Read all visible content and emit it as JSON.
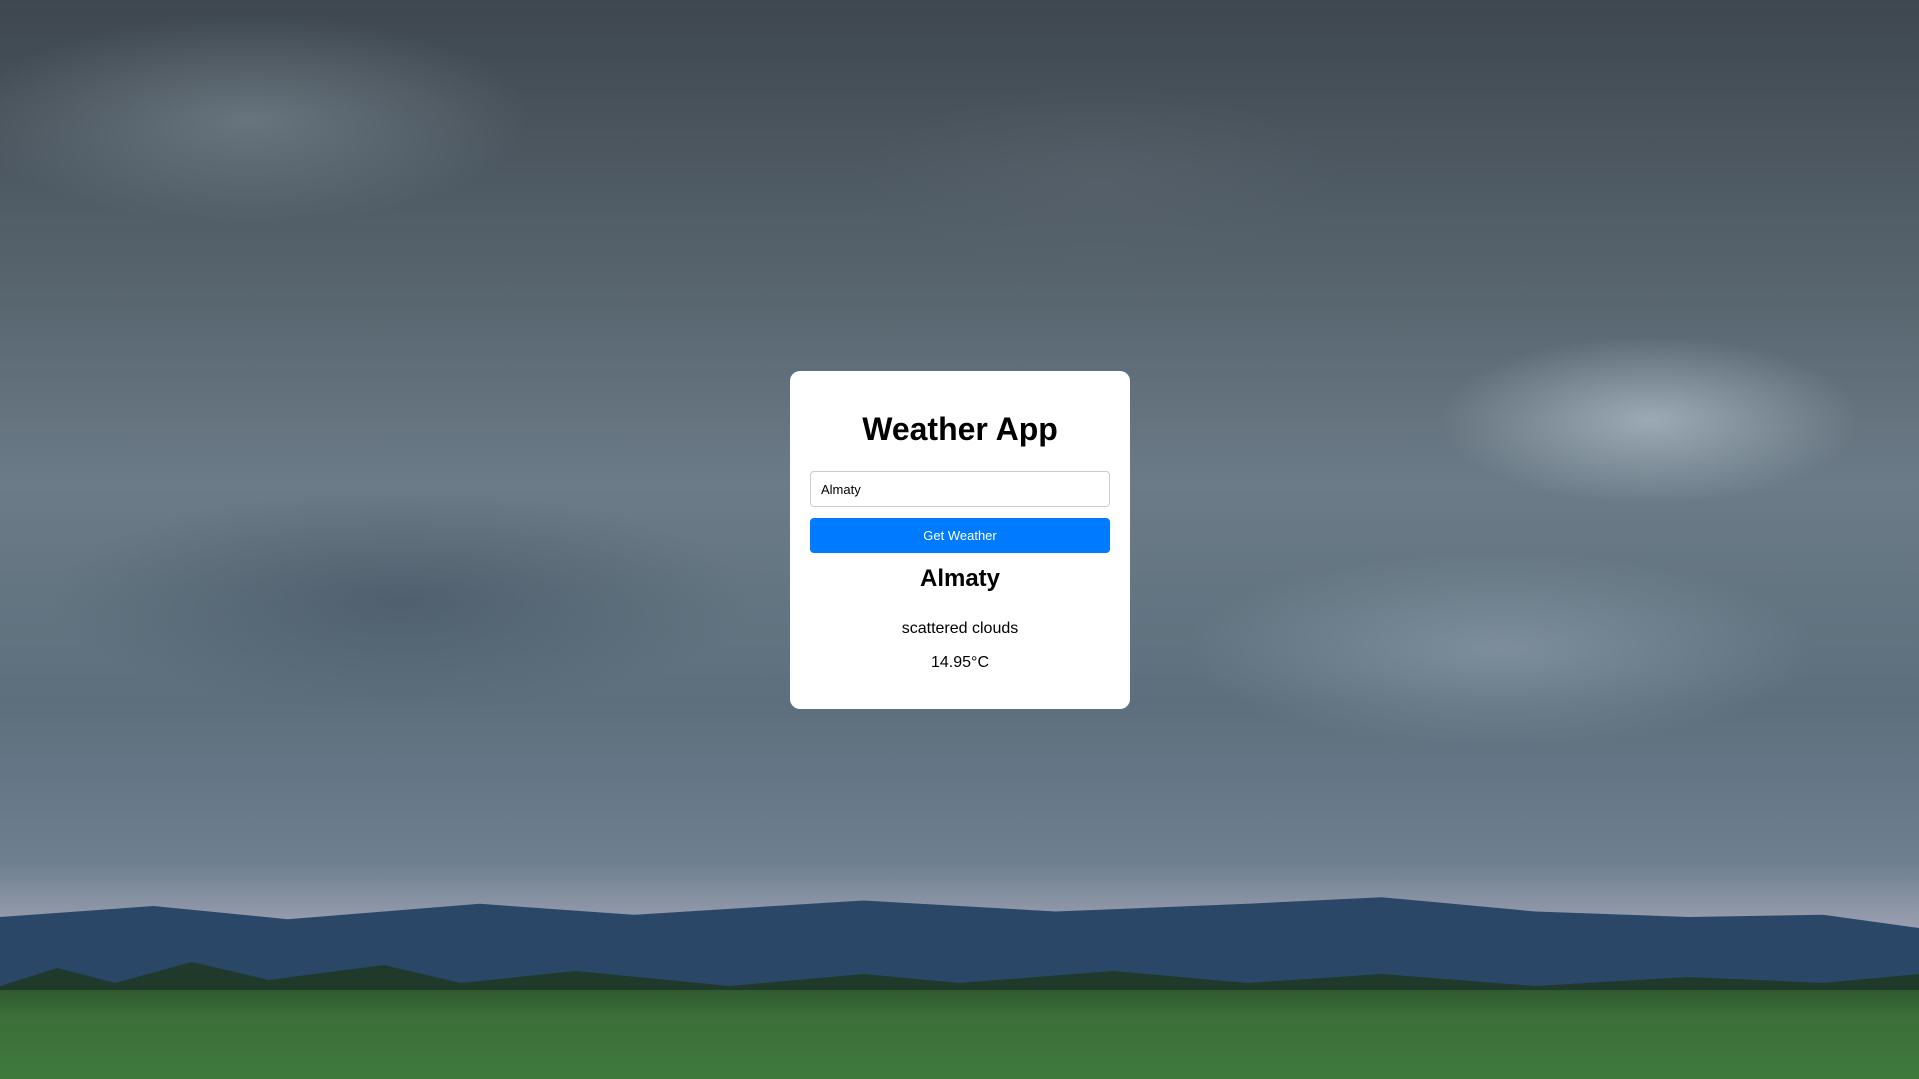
{
  "app": {
    "title": "Weather App"
  },
  "search": {
    "value": "Almaty",
    "button_label": "Get Weather"
  },
  "result": {
    "city": "Almaty",
    "description": "scattered clouds",
    "temperature": "14.95°C"
  },
  "colors": {
    "accent": "#007bff",
    "card": "#ffffff"
  }
}
